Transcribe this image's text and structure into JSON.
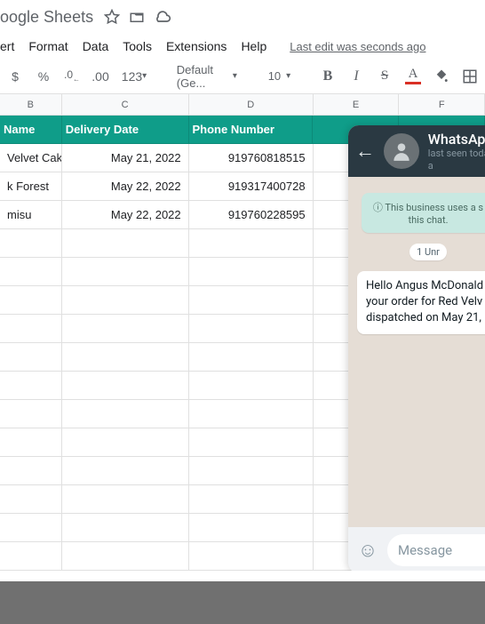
{
  "titlebar": {
    "app_name": "oogle Sheets"
  },
  "menubar": {
    "items": [
      "ert",
      "Format",
      "Data",
      "Tools",
      "Extensions",
      "Help"
    ],
    "last_edit": "Last edit was seconds ago"
  },
  "toolbar": {
    "currency": "$",
    "percent": "%",
    "dec_dec": ".0",
    "dec_inc": ".00",
    "num_format": "123",
    "font": "Default (Ge...",
    "size": "10",
    "bold": "B",
    "italic": "I",
    "strike": "S",
    "text_color": "A"
  },
  "columns": [
    "B",
    "C",
    "D",
    "E",
    "F"
  ],
  "sheet": {
    "headers": {
      "b": "Name",
      "c": "Delivery Date",
      "d": "Phone Number"
    },
    "rows": [
      {
        "b": "Velvet Cake",
        "c": "May 21, 2022",
        "d": "919760818515"
      },
      {
        "b": "k Forest",
        "c": "May 22, 2022",
        "d": "919317400728"
      },
      {
        "b": "misu",
        "c": "May 22, 2022",
        "d": "919760228595"
      }
    ]
  },
  "whatsapp": {
    "name": "WhatsApp",
    "status": "last seen today a",
    "notice": "This business uses a s this chat.",
    "unread": "1 Unr",
    "message": "Hello Angus McDonald your order for Red Velv dispatched on May 21,",
    "input_placeholder": "Message"
  }
}
